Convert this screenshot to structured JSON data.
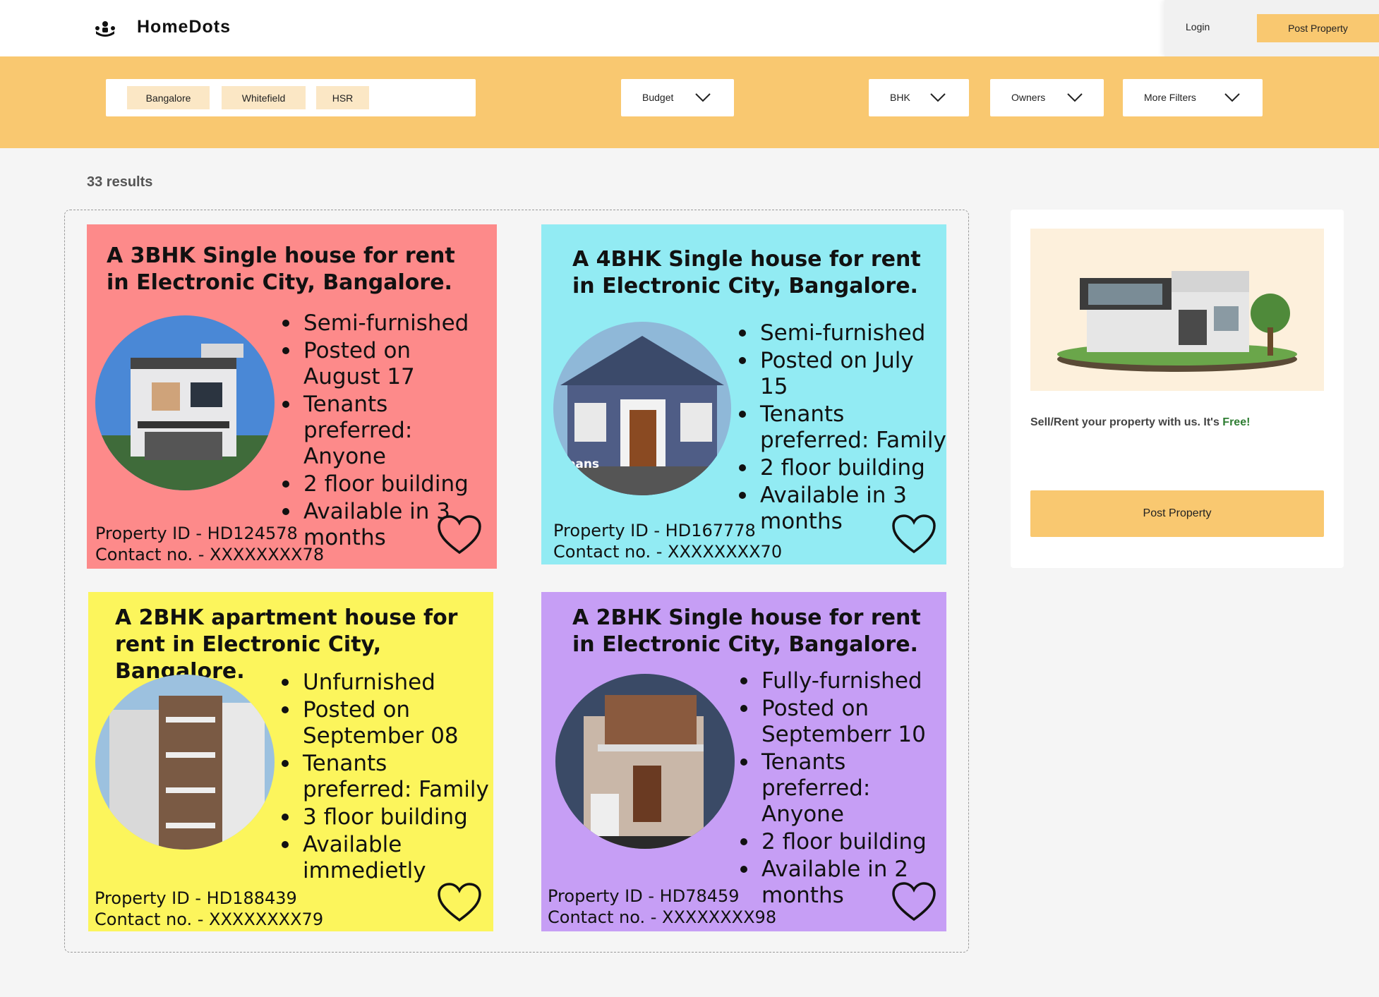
{
  "header": {
    "brand": "HomeDots",
    "login_label": "Login",
    "post_property_label": "Post Property"
  },
  "filters": {
    "locations": [
      "Bangalore",
      "Whitefield",
      "HSR"
    ],
    "budget_label": "Budget",
    "bhk_label": "BHK",
    "owners_label": "Owners",
    "more_filters_label": "More Filters"
  },
  "results_count": "33 results",
  "listings": [
    {
      "title": "A 3BHK Single house for rent in Electronic City, Bangalore.",
      "features": [
        "Semi-furnished",
        "Posted on August 17",
        "Tenants preferred: Anyone",
        "2 floor building",
        "Available in 3 months"
      ],
      "property_id": "Property ID  - HD124578",
      "contact": "Contact no. - XXXXXXXX78",
      "color": "#fd8a8a"
    },
    {
      "title": "A 4BHK Single house for rent in Electronic City, Bangalore.",
      "features": [
        "Semi-furnished",
        "Posted on July 15",
        "Tenants preferred: Family",
        "2 floor building",
        "Available in 3 months"
      ],
      "property_id": "Property ID  - HD167778",
      "contact": "Contact no. - XXXXXXXX70",
      "color": "#92ebf3"
    },
    {
      "title": "A 2BHK apartment house for rent in Electronic City, Bangalore.",
      "features": [
        "Unfurnished",
        "Posted on September 08",
        "Tenants preferred: Family",
        "3 floor building",
        "Available immedietly"
      ],
      "property_id": "Property ID  - HD188439",
      "contact": "Contact no. - XXXXXXXX79",
      "color": "#fcf55c"
    },
    {
      "title": "A 2BHK Single house for rent in Electronic City, Bangalore.",
      "features": [
        "Fully-furnished",
        "Posted on Septemberr 10",
        "Tenants preferred: Anyone",
        "2 floor building",
        "Available in 2 months"
      ],
      "property_id": "Property ID  - HD78459",
      "contact": "Contact no. - XXXXXXXX98",
      "color": "#c69ef5"
    }
  ],
  "listing_photo_overlay": "leans",
  "side_panel": {
    "text": "Sell/Rent your property with us. It's",
    "free": "Free!",
    "button_label": "Post Property"
  },
  "icons": {
    "logo": "people-logo-icon",
    "dropdown": "chevron-down-icon",
    "favorite": "heart-outline-icon"
  }
}
